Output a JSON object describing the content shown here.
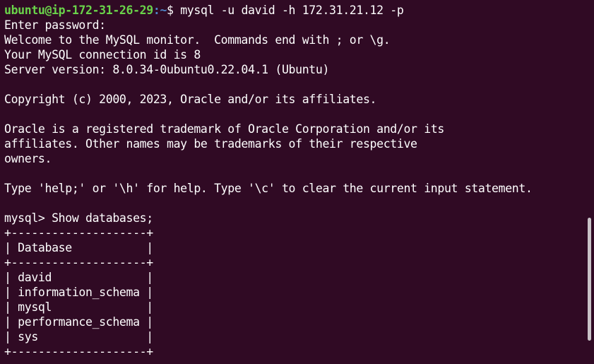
{
  "theme": {
    "background": "#300a24",
    "foreground": "#ffffff",
    "prompt_user_color": "#6ad34a",
    "prompt_path_color": "#4f86c9",
    "scrollbar_color": "#c9c2c7"
  },
  "prompt": {
    "user_host": "ubuntu@ip-172-31-26-29",
    "path": ":~",
    "symbol": "$ ",
    "command": "mysql -u david -h 172.31.21.12 -p"
  },
  "lines": [
    "Enter password:",
    "Welcome to the MySQL monitor.  Commands end with ; or \\g.",
    "Your MySQL connection id is 8",
    "Server version: 8.0.34-0ubuntu0.22.04.1 (Ubuntu)",
    "",
    "Copyright (c) 2000, 2023, Oracle and/or its affiliates.",
    "",
    "Oracle is a registered trademark of Oracle Corporation and/or its",
    "affiliates. Other names may be trademarks of their respective",
    "owners.",
    "",
    "Type 'help;' or '\\h' for help. Type '\\c' to clear the current input statement.",
    "",
    "mysql> Show databases;",
    "+--------------------+",
    "| Database           |",
    "+--------------------+",
    "| david              |",
    "| information_schema |",
    "| mysql              |",
    "| performance_schema |",
    "| sys                |",
    "+--------------------+"
  ]
}
